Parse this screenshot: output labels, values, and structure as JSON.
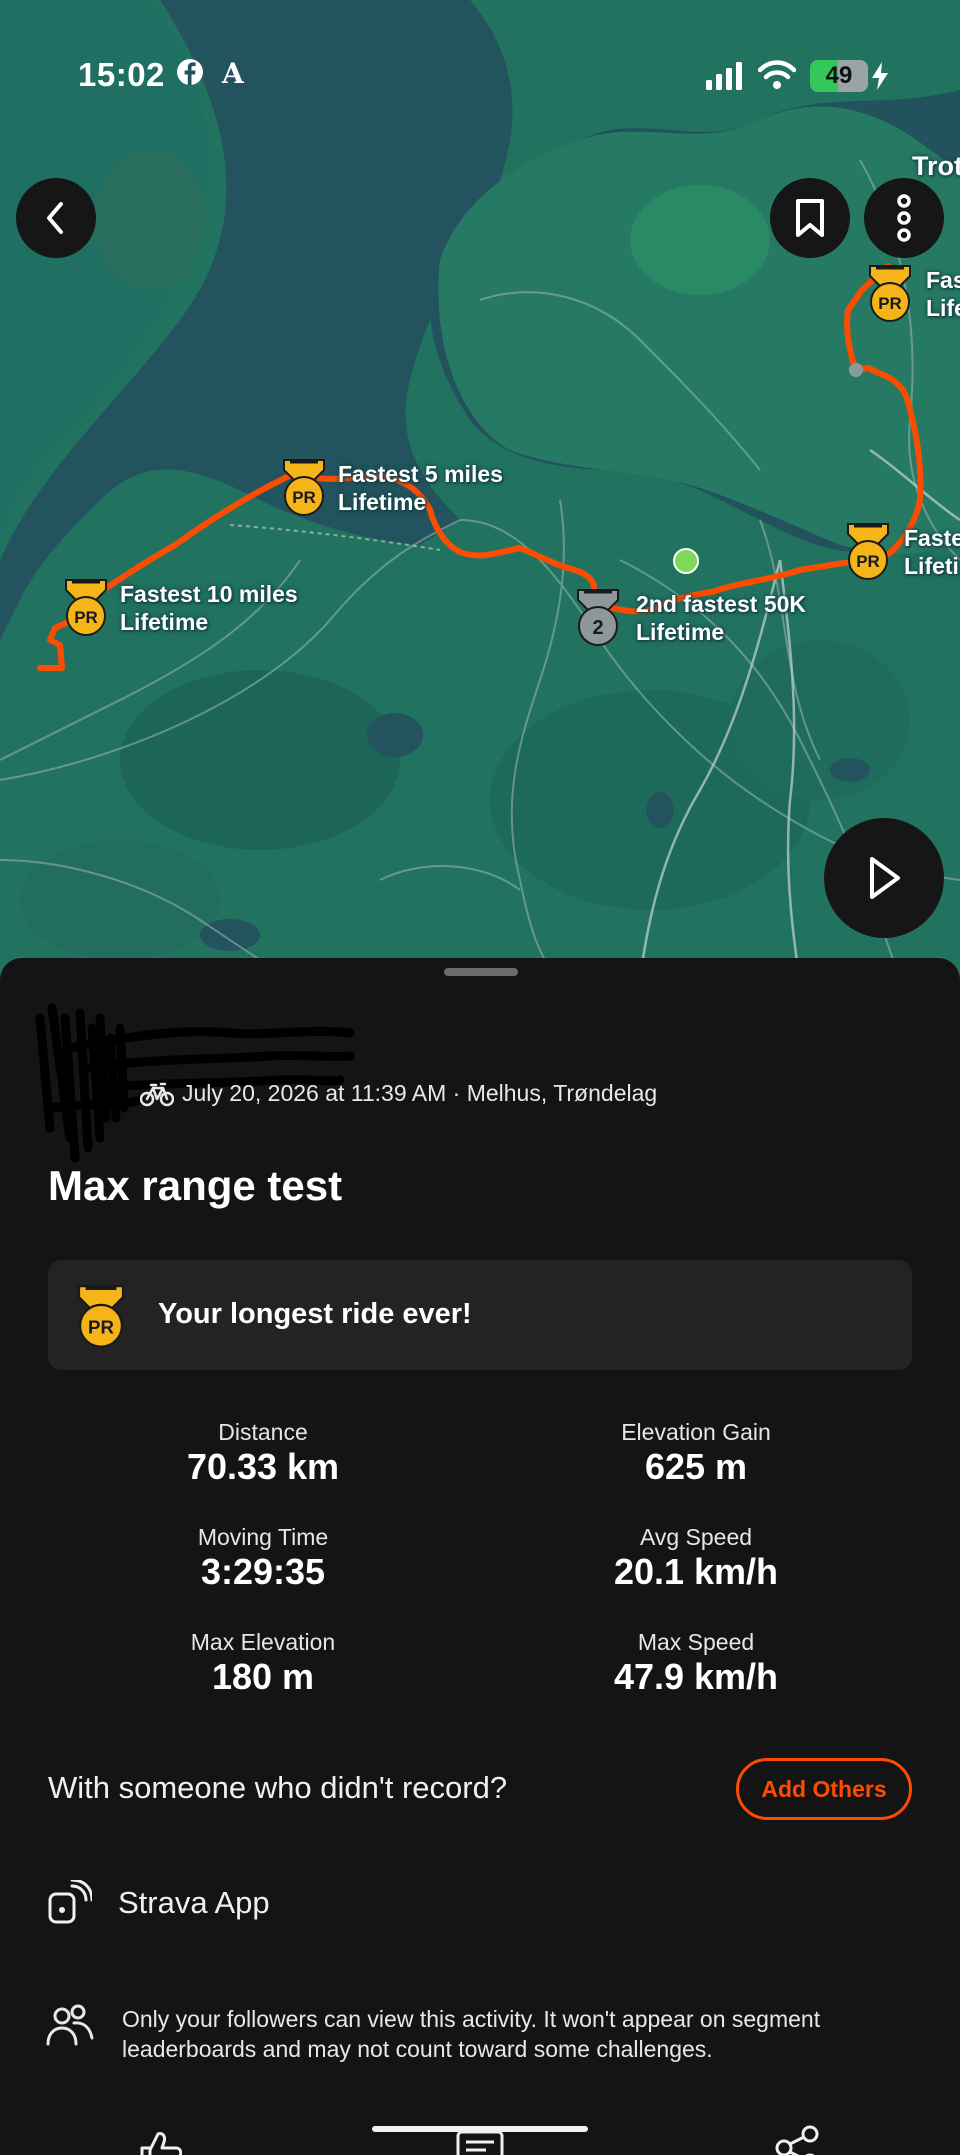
{
  "status_bar": {
    "time": "15:02",
    "battery_level": "49",
    "icons": [
      "facebook-icon",
      "aftenposten-icon",
      "signal-icon",
      "wifi-icon",
      "battery-icon",
      "charging-icon"
    ]
  },
  "map": {
    "place_label": "Trot",
    "medals": [
      {
        "badge": "PR",
        "line1": "Fastest 10 miles",
        "line2": "Lifetime"
      },
      {
        "badge": "PR",
        "line1": "Fastest 5 miles",
        "line2": "Lifetime"
      },
      {
        "badge": "2",
        "line1": "2nd fastest 50K",
        "line2": "Lifetime"
      },
      {
        "badge": "PR",
        "line1": "Faste",
        "line2": "Lifeti"
      },
      {
        "badge": "PR",
        "line1": "Fas",
        "line2": "Life"
      }
    ],
    "route_color": "#fc4c02",
    "start_marker_color": "#7ed957"
  },
  "activity": {
    "meta": "July 20, 2026 at 11:39 AM · Melhus, Trøndelag",
    "title": "Max range test",
    "achievement": {
      "badge": "PR",
      "text": "Your longest ride ever!"
    },
    "stats": [
      {
        "label": "Distance",
        "value": "70.33 km"
      },
      {
        "label": "Elevation Gain",
        "value": "625 m"
      },
      {
        "label": "Moving Time",
        "value": "3:29:35"
      },
      {
        "label": "Avg Speed",
        "value": "20.1 km/h"
      },
      {
        "label": "Max Elevation",
        "value": "180 m"
      },
      {
        "label": "Max Speed",
        "value": "47.9 km/h"
      }
    ],
    "others_prompt": "With someone who didn't record?",
    "add_others_label": "Add Others",
    "device": "Strava App",
    "privacy_note": "Only your followers can view this activity. It won't appear on segment leaderboards and may not count toward some challenges."
  },
  "colors": {
    "accent": "#fc4c02",
    "pr_gold": "#f5b417",
    "background": "#141414",
    "card": "#232323"
  }
}
